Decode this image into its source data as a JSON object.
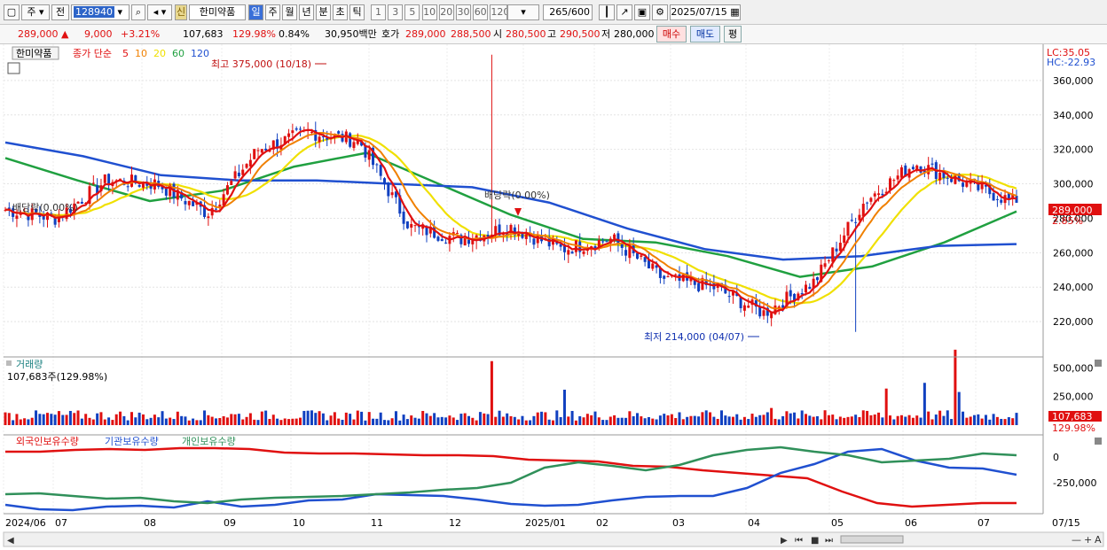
{
  "toolbar": {
    "period": "주",
    "scope": "전",
    "code": "128940",
    "badge": "신",
    "stock_name": "한미약품",
    "periods": [
      "일",
      "주",
      "월",
      "년",
      "분",
      "초",
      "틱"
    ],
    "minutes": [
      "1",
      "3",
      "5",
      "10",
      "20",
      "30",
      "60",
      "120"
    ],
    "count": "265",
    "count_total": "/600",
    "date": "2025/07/15"
  },
  "info": {
    "price": "289,000 ▲",
    "change": "9,000",
    "change_pct": "+3.21%",
    "volume": "107,683",
    "volume_ratio": "129.98%",
    "turnover": "0.84%",
    "amount": "30,950백만",
    "bid_label": "호가",
    "bid": "289,000",
    "ask": "288,500",
    "open_label": "시",
    "open": "280,500",
    "high_label": "고",
    "high": "290,500",
    "low_label": "저",
    "low": "280,000",
    "buy_label": "매수",
    "sell_label": "매도",
    "eval_label": "평"
  },
  "price_panel": {
    "name_tag": "한미약품",
    "ma_title": "종가 단순",
    "ma_labels": [
      "5",
      "10",
      "20",
      "60",
      "120"
    ],
    "ma_colors": [
      "#e01010",
      "#f08000",
      "#f0e000",
      "#20a040",
      "#2050d0"
    ],
    "lc": "LC:35.05",
    "hc": "HC:-22.93",
    "price_tag": "289,000",
    "pct_tag": "2.85%",
    "high_annot": "최고 375,000 (10/18)",
    "low_annot": "최저 214,000 (04/07)",
    "div1": "배당락(0.00%)",
    "div2": "배당락(0.00%)"
  },
  "volume_panel": {
    "title": "거래량",
    "value": "107,683주(129.98%)",
    "tag1": "107,683",
    "tag2": "129.98%"
  },
  "holding_panel": {
    "foreign": "외국인보유수량",
    "inst": "기관보유수량",
    "indiv": "개인보유수량"
  },
  "chart_data": [
    {
      "type": "candlestick",
      "title": "한미약품",
      "x": [
        "2024-06",
        "2024-07",
        "2024-08",
        "2024-09",
        "2024-10",
        "2024-11",
        "2024-12",
        "2025-01",
        "2025-02",
        "2025-03",
        "2025-04",
        "2025-05",
        "2025-06",
        "2025-07"
      ],
      "x_tick_labels": [
        "2024/06",
        "07",
        "08",
        "09",
        "10",
        "11",
        "12",
        "2025/01",
        "02",
        "03",
        "04",
        "05",
        "06",
        "07",
        "07/15"
      ],
      "close_path": [
        285000,
        280000,
        302000,
        300000,
        283000,
        320000,
        330000,
        325000,
        275000,
        268000,
        275000,
        262000,
        268000,
        245000,
        240000,
        225000,
        243000,
        290000,
        312000,
        300000,
        289000
      ],
      "ma_5_10_20_60_120": "series",
      "ma_60": [
        315000,
        302000,
        290000,
        296000,
        310000,
        318000,
        300000,
        282000,
        268000,
        266000,
        258000,
        246000,
        252000,
        266000,
        284000
      ],
      "ma_120": [
        324000,
        316000,
        305000,
        302000,
        302000,
        300000,
        298000,
        289000,
        274000,
        262000,
        256000,
        258000,
        264000,
        265000
      ],
      "y_ticks": [
        360000,
        340000,
        320000,
        300000,
        280000,
        260000,
        240000,
        220000
      ],
      "high_annotation": {
        "label": "최고 375,000 (10/18)",
        "value": 375000
      },
      "low_annotation": {
        "label": "최저 214,000 (04/07)",
        "value": 214000
      },
      "last": 289000
    },
    {
      "type": "bar",
      "title": "거래량",
      "y_ticks": [
        500000,
        250000
      ],
      "last": 107683
    },
    {
      "type": "line",
      "series": [
        {
          "name": "외국인보유수량",
          "color": "#e01010"
        },
        {
          "name": "기관보유수량",
          "color": "#2050d0"
        },
        {
          "name": "개인보유수량",
          "color": "#30905a"
        }
      ],
      "y_ticks": [
        0,
        -250000
      ]
    }
  ]
}
